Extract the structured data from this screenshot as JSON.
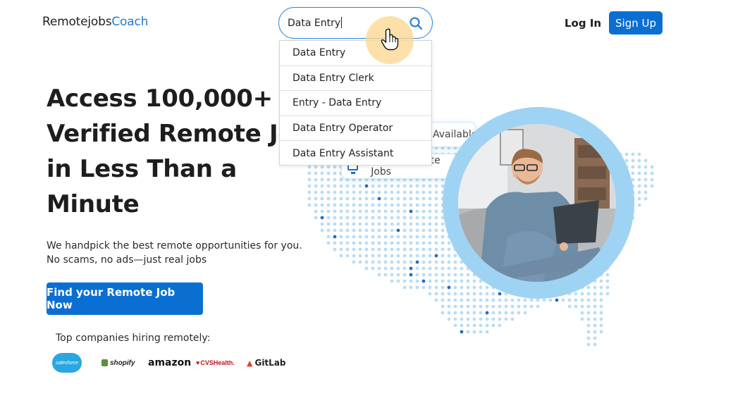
{
  "header": {
    "logo_part1": "Remotejobs",
    "logo_part2": "Coach",
    "search_value": "Data Entry",
    "login_label": "Log In",
    "signup_label": "Sign Up"
  },
  "suggestions": [
    "Data Entry",
    "Data Entry Clerk",
    "Entry - Data Entry",
    "Data Entry Operator",
    "Data Entry Assistant"
  ],
  "hero": {
    "headline_lines": [
      "Access 100,000+",
      "Verified Remote Jobs",
      "in Less Than a",
      "Minute"
    ],
    "sub_lines": [
      "We handpick the best remote opportunities for you.",
      "No scams, no ads—just real jobs"
    ],
    "cta_label": "Find your Remote Job Now",
    "companies_label": "Top companies hiring remotely:"
  },
  "companies": [
    "salesforce",
    "shopify",
    "amazon",
    "CVSHealth.",
    "GitLab"
  ],
  "badges": {
    "available": "Available",
    "remote_jobs": "100% Remote Jobs"
  },
  "colors": {
    "brand_blue": "#0b6fd2",
    "logo_accent": "#1f7bd0",
    "map_dot": "#b9dcf4",
    "map_dot_accent": "#1f6ec8",
    "ring": "#9fd3f3"
  }
}
